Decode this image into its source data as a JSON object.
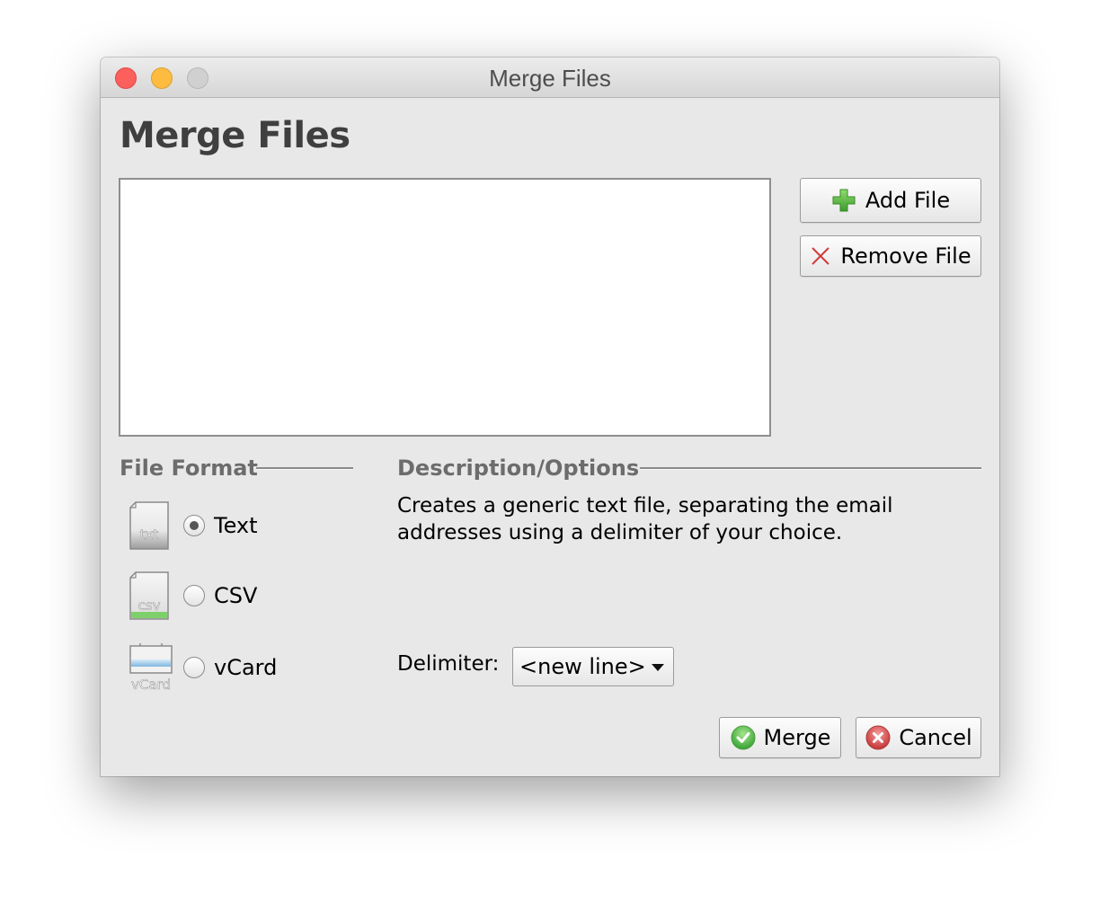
{
  "window": {
    "title": "Merge Files",
    "traffic_lights": [
      "close",
      "minimize",
      "zoom"
    ]
  },
  "heading": "Merge Files",
  "file_list": {
    "items": []
  },
  "buttons": {
    "add_file": {
      "label": "Add File",
      "icon": "plus-icon",
      "color": "#5cb947"
    },
    "remove_file": {
      "label": "Remove File",
      "icon": "x-icon",
      "color": "#d23b3b"
    },
    "merge": {
      "label": "Merge",
      "icon": "check-circle-icon",
      "color": "#5cc153"
    },
    "cancel": {
      "label": "Cancel",
      "icon": "x-circle-icon",
      "color": "#e05a5a"
    }
  },
  "file_format": {
    "section_label": "File Format",
    "selected": "Text",
    "options": [
      {
        "label": "Text",
        "icon": "txt-file-icon",
        "icon_text": "txt",
        "selected": true
      },
      {
        "label": "CSV",
        "icon": "csv-file-icon",
        "icon_text": "csv",
        "selected": false
      },
      {
        "label": "vCard",
        "icon": "vcard-icon",
        "icon_text": "vCard",
        "selected": false
      }
    ]
  },
  "description": {
    "section_label": "Description/Options",
    "text": "Creates a generic text file, separating the email addresses using a delimiter of your choice."
  },
  "delimiter": {
    "label": "Delimiter:",
    "value": "<new line>"
  }
}
